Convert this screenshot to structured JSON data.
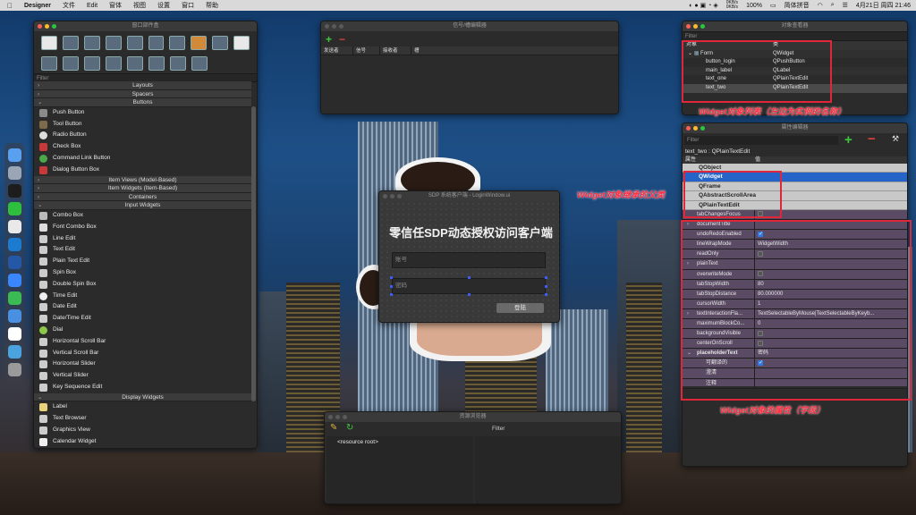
{
  "menubar": {
    "app_name": "Designer",
    "items": [
      "文件",
      "Edit",
      "窗体",
      "视图",
      "设置",
      "窗口",
      "帮助"
    ],
    "status": {
      "network_speed": "0KB/s\n0KB/s",
      "battery": "100%",
      "input_method": "简体拼音",
      "datetime": "4月21日 周四  21:46"
    }
  },
  "widget_box": {
    "title": "窗口部件盒",
    "filter_label": "Filter",
    "categories": {
      "layouts": "Layouts",
      "spacers": "Spacers",
      "buttons": "Buttons",
      "item_views": "Item Views (Model-Based)",
      "item_widgets": "Item Widgets (Item-Based)",
      "containers": "Containers",
      "input_widgets": "Input Widgets",
      "display_widgets": "Display Widgets"
    },
    "button_items": [
      "Push Button",
      "Tool Button",
      "Radio Button",
      "Check Box",
      "Command Link Button",
      "Dialog Button Box"
    ],
    "input_items": [
      "Combo Box",
      "Font Combo Box",
      "Line Edit",
      "Text Edit",
      "Plain Text Edit",
      "Spin Box",
      "Double Spin Box",
      "Time Edit",
      "Date Edit",
      "Date/Time Edit",
      "Dial",
      "Horizontal Scroll Bar",
      "Vertical Scroll Bar",
      "Horizontal Slider",
      "Vertical Slider",
      "Key Sequence Edit"
    ],
    "display_items": [
      "Label",
      "Text Browser",
      "Graphics View",
      "Calendar Widget"
    ]
  },
  "signal_slot_editor": {
    "title": "信号/槽编辑器",
    "columns": [
      "发送者",
      "信号",
      "接收者",
      "槽"
    ]
  },
  "object_inspector": {
    "title": "对象查看器",
    "filter_label": "Filter",
    "col_object": "对象",
    "col_class": "类",
    "rows": [
      {
        "name": "Form",
        "cls": "QWidget"
      },
      {
        "name": "button_login",
        "cls": "QPushButton"
      },
      {
        "name": "main_label",
        "cls": "QLabel"
      },
      {
        "name": "text_one",
        "cls": "QPlainTextEdit"
      },
      {
        "name": "text_two",
        "cls": "QPlainTextEdit"
      }
    ]
  },
  "property_editor": {
    "title": "属性编辑器",
    "filter_label": "Filter",
    "object_label": "text_two : QPlainTextEdit",
    "col_prop": "属性",
    "col_value": "值",
    "classes": [
      "QObject",
      "QWidget",
      "QFrame",
      "QAbstractScrollArea",
      "QPlainTextEdit"
    ],
    "props": [
      {
        "k": "tabChangesFocus",
        "v": "",
        "chk": "off"
      },
      {
        "k": "documentTitle",
        "v": "",
        "chk": ""
      },
      {
        "k": "undoRedoEnabled",
        "v": "",
        "chk": "on"
      },
      {
        "k": "lineWrapMode",
        "v": "WidgetWidth",
        "chk": ""
      },
      {
        "k": "readOnly",
        "v": "",
        "chk": "off"
      },
      {
        "k": "plainText",
        "v": "",
        "chk": ""
      },
      {
        "k": "overwriteMode",
        "v": "",
        "chk": "off"
      },
      {
        "k": "tabStopWidth",
        "v": "80",
        "chk": ""
      },
      {
        "k": "tabStopDistance",
        "v": "80.000000",
        "chk": ""
      },
      {
        "k": "cursorWidth",
        "v": "1",
        "chk": ""
      },
      {
        "k": "textInteractionFla...",
        "v": "TextSelectableByMouse|TextSelectableByKeyb...",
        "chk": ""
      },
      {
        "k": "maximumBlockCo...",
        "v": "0",
        "chk": ""
      },
      {
        "k": "backgroundVisible",
        "v": "",
        "chk": "off"
      },
      {
        "k": "centerOnScroll",
        "v": "",
        "chk": "off"
      },
      {
        "k": "placeholderText",
        "v": "密码",
        "chk": ""
      },
      {
        "k": "可翻译的",
        "v": "",
        "chk": "on"
      },
      {
        "k": "澄清",
        "v": "",
        "chk": ""
      },
      {
        "k": "注释",
        "v": "",
        "chk": ""
      }
    ]
  },
  "form_window": {
    "title": "SDP 系统客户端 - LoginWindow.ui",
    "main_label": "零信任SDP动态授权访问客户端",
    "account_placeholder": "账号",
    "password_placeholder": "密码",
    "login_button": "登陆"
  },
  "resource_browser": {
    "title": "资源浏览器",
    "filter_label": "Filter",
    "root_item": "<resource root>"
  },
  "annotations": {
    "widget_list": "Widget对象列表（左边为实例的名称）",
    "parent_classes": "Widget对象继承的父类",
    "properties": "Widget对象的属性（字段）"
  },
  "colors": {
    "annotation_red": "#e0273a",
    "selection_blue": "#2563c9",
    "property_row_purple": "#5a4a63"
  }
}
